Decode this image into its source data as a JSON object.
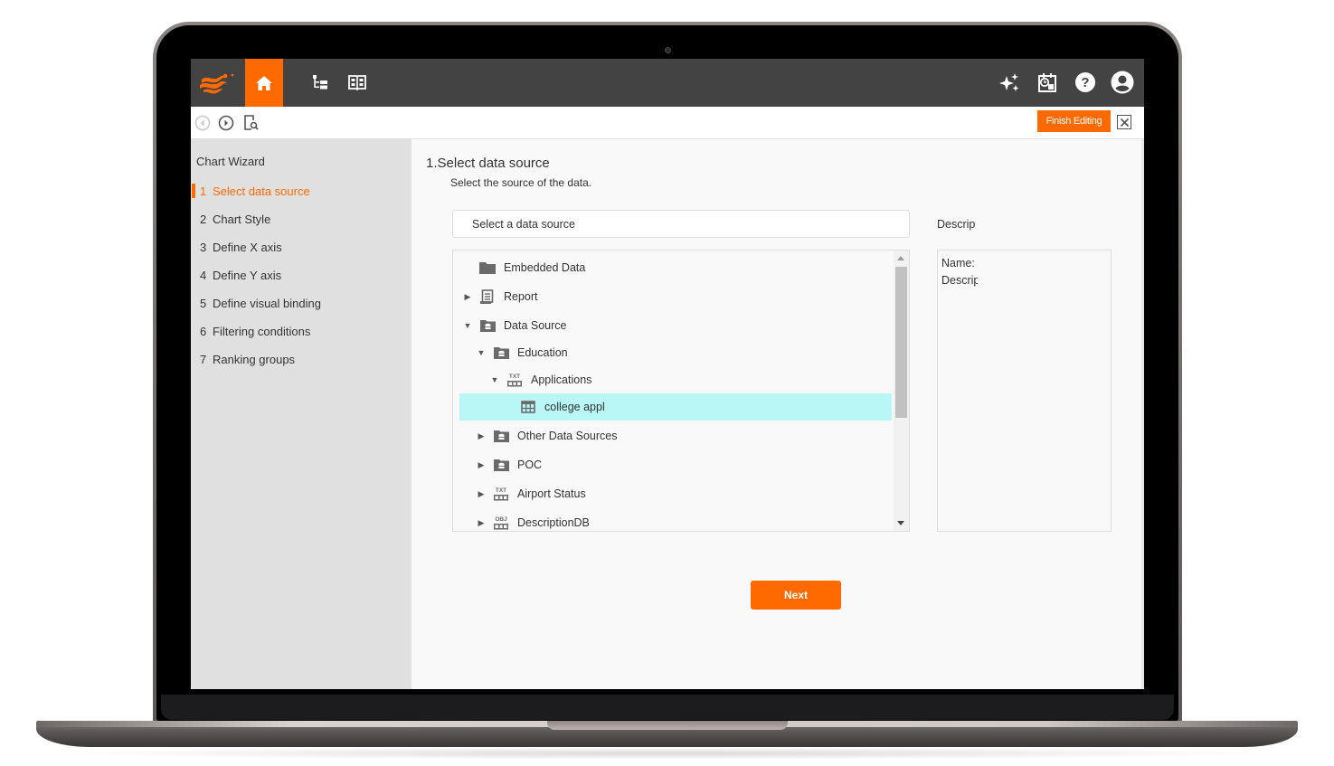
{
  "colors": {
    "accent": "#ff6a00",
    "topbar": "#434343",
    "sidebar_bg": "#e0e0e0",
    "selected_row": "#b9f6f6"
  },
  "topbar": {
    "icons": [
      "logo-icon",
      "home-icon",
      "tree-structure-icon",
      "book-icon",
      "sparkle-icon",
      "schedule-icon",
      "help-icon",
      "user-account-icon"
    ]
  },
  "toolbar": {
    "finish_label": "Finish Editing",
    "icons": [
      "back-icon",
      "forward-icon",
      "preview-icon",
      "close-icon"
    ]
  },
  "sidebar": {
    "title": "Chart Wizard",
    "items": [
      {
        "num": "1",
        "label": "Select data source",
        "active": true
      },
      {
        "num": "2",
        "label": "Chart Style"
      },
      {
        "num": "3",
        "label": "Define X axis"
      },
      {
        "num": "4",
        "label": "Define Y axis"
      },
      {
        "num": "5",
        "label": "Define visual binding"
      },
      {
        "num": "6",
        "label": "Filtering conditions"
      },
      {
        "num": "7",
        "label": "Ranking groups"
      }
    ]
  },
  "main": {
    "title": "1.Select data source",
    "description": "Select the source of the data.",
    "input_placeholder": "Select a data source",
    "descrip_label": "Descrip",
    "tree": [
      {
        "label": "Embedded Data",
        "icon": "folder-icon",
        "caret": "none",
        "level": 0
      },
      {
        "label": "Report",
        "icon": "report-icon",
        "caret": "collapsed",
        "level": 0
      },
      {
        "label": "Data Source",
        "icon": "database-folder-icon",
        "caret": "expanded",
        "level": 0
      },
      {
        "label": "Education",
        "icon": "database-folder-icon",
        "caret": "expanded",
        "level": 1
      },
      {
        "label": "Applications",
        "icon": "txt-source-icon",
        "caret": "expanded",
        "level": 2
      },
      {
        "label": "college appl",
        "icon": "table-icon",
        "caret": "none",
        "level": 3,
        "selected": true
      },
      {
        "label": "Other Data Sources",
        "icon": "database-folder-icon",
        "caret": "collapsed",
        "level": 1
      },
      {
        "label": "POC",
        "icon": "database-folder-icon",
        "caret": "collapsed",
        "level": 1
      },
      {
        "label": "Airport Status",
        "icon": "txt-source-icon",
        "caret": "collapsed",
        "level": 1
      },
      {
        "label": "DescriptionDB",
        "icon": "obj-source-icon",
        "caret": "collapsed",
        "level": 1
      }
    ],
    "details": {
      "name_label": "Name:",
      "description_label": "Descrip"
    },
    "next_label": "Next"
  }
}
